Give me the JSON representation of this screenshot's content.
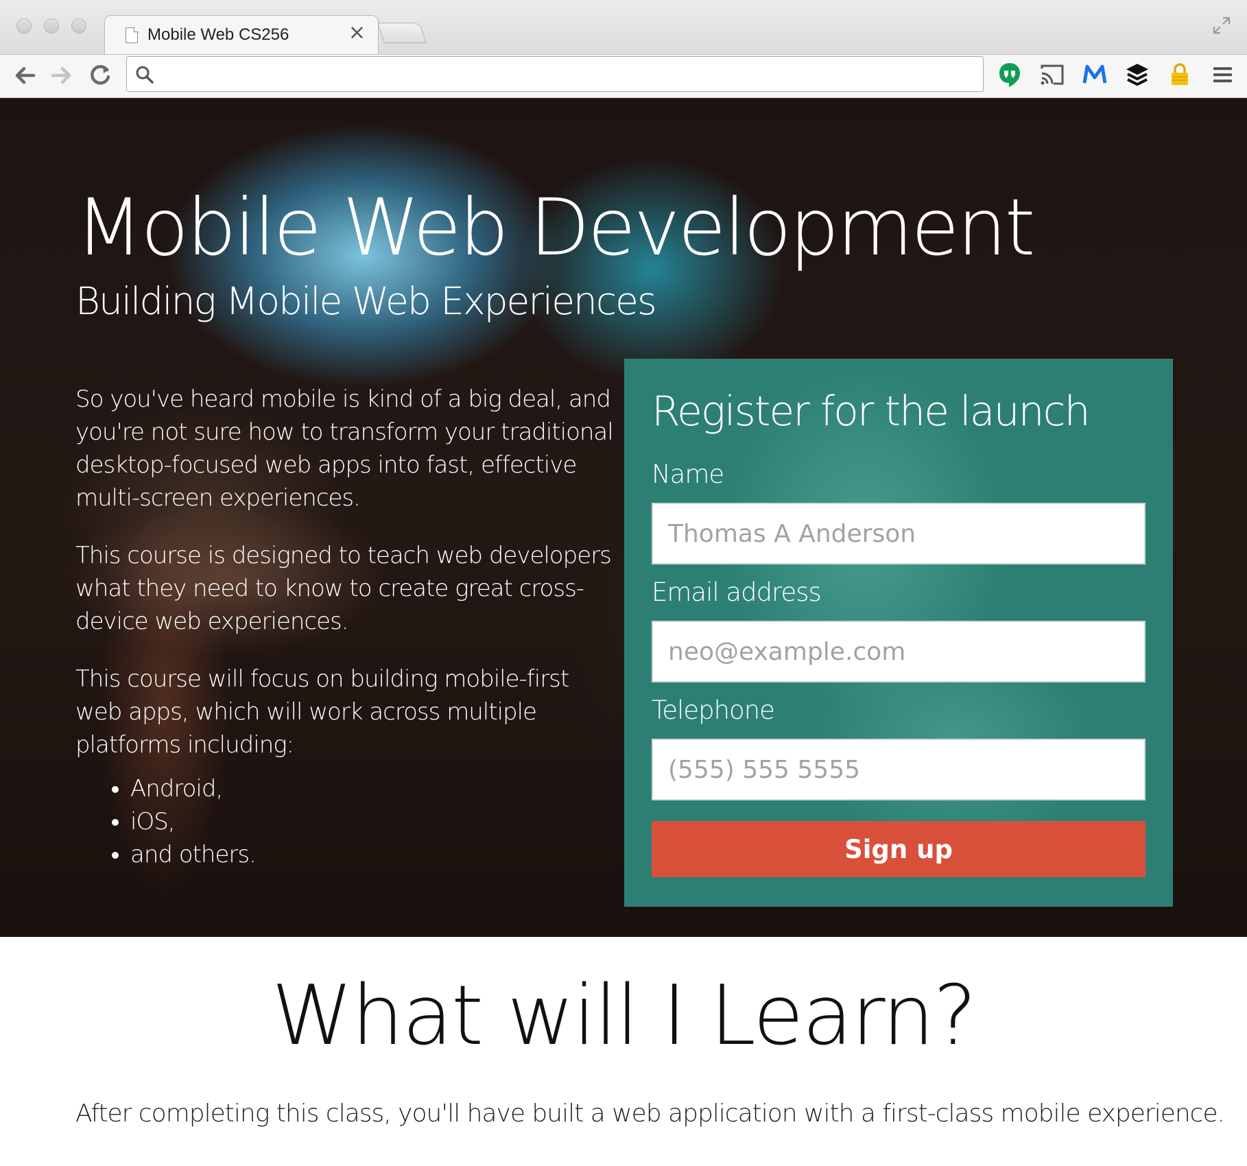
{
  "browser": {
    "tab_title": "Mobile Web CS256",
    "tab_close": "×",
    "omnibox_value": ""
  },
  "icons": {
    "traffic_lights": [
      "close-window-icon",
      "minimize-window-icon",
      "zoom-window-icon"
    ],
    "extensions": [
      "hangouts-icon",
      "cast-icon",
      "mailchimp-m-icon",
      "buffer-stack-icon",
      "lastpass-lock-icon",
      "menu-icon"
    ]
  },
  "colors": {
    "register_panel": "#2d7f74",
    "signup_button": "#d9503a",
    "hangouts_green": "#0f9d58",
    "m_blue": "#1a73e8",
    "lock_yellow": "#f4c20d"
  },
  "hero": {
    "title": "Mobile Web Development",
    "subtitle": "Building Mobile Web Experiences",
    "paragraphs": [
      "So you've heard mobile is kind of a big deal, and you're not sure how to transform your traditional desktop-focused web apps into fast, effective multi-screen experiences.",
      "This course is designed to teach web developers what they need to know to create great cross-device web experiences.",
      "This course will focus on building mobile-first web apps, which will work across multiple platforms including:"
    ],
    "platforms": [
      "Android,",
      "iOS,",
      "and others."
    ]
  },
  "register": {
    "title": "Register for the launch",
    "name_label": "Name",
    "name_placeholder": "Thomas A Anderson",
    "email_label": "Email address",
    "email_placeholder": "neo@example.com",
    "phone_label": "Telephone",
    "phone_placeholder": "(555) 555 5555",
    "submit_label": "Sign up"
  },
  "learn": {
    "title": "What will I Learn?",
    "paragraphs": [
      "After completing this class, you'll have built a web application with a first-class mobile experience."
    ]
  }
}
